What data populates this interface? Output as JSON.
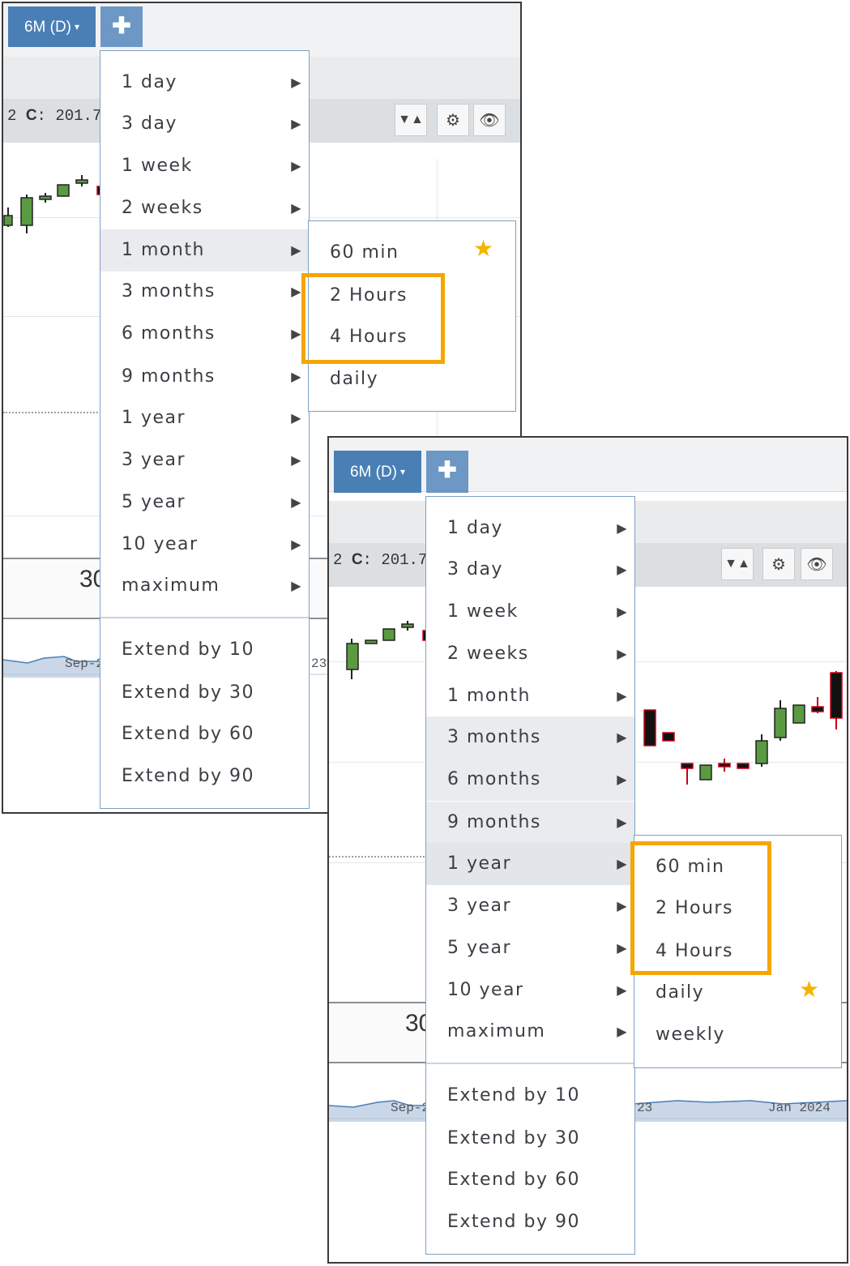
{
  "toolbar": {
    "range_label": "6M (D)",
    "range_caret": "▾",
    "add_label": "✚"
  },
  "infobar": {
    "prefix": "2",
    "close_key": "C",
    "close_value": ": 201.70"
  },
  "icons": {
    "triangles": "▼▲",
    "gear": "⚙",
    "eye": "👁",
    "submenu_arrow": "▶",
    "star": "★"
  },
  "chart": {
    "visible_number": "30",
    "nav_labels": [
      "Sep-2",
      "23",
      "Jan 2024"
    ]
  },
  "menu": {
    "items": [
      "1 day",
      "3 day",
      "1 week",
      "2 weeks",
      "1 month",
      "3 months",
      "6 months",
      "9 months",
      "1 year",
      "3 year",
      "5 year",
      "10 year",
      "maximum"
    ],
    "extend_items": [
      "Extend by 10",
      "Extend by 30",
      "Extend by 60",
      "Extend by 90"
    ]
  },
  "left_panel": {
    "active_item": "1 month",
    "submenu": [
      "60 min",
      "2 Hours",
      "4 Hours",
      "daily"
    ],
    "favorite": "60 min",
    "highlighted": [
      "2 Hours",
      "4 Hours"
    ]
  },
  "right_panel": {
    "active_item": "1 year",
    "hover_item": "3 months",
    "submenu": [
      "60 min",
      "2 Hours",
      "4 Hours",
      "daily",
      "weekly"
    ],
    "favorite": "daily",
    "highlighted": [
      "60 min",
      "2 Hours",
      "4 Hours"
    ]
  },
  "colors": {
    "accent": "#4a7fb5",
    "highlight": "#f5a600",
    "star": "#f5b400",
    "up_candle": "#5a9a40",
    "down_candle": "#c4001a"
  }
}
